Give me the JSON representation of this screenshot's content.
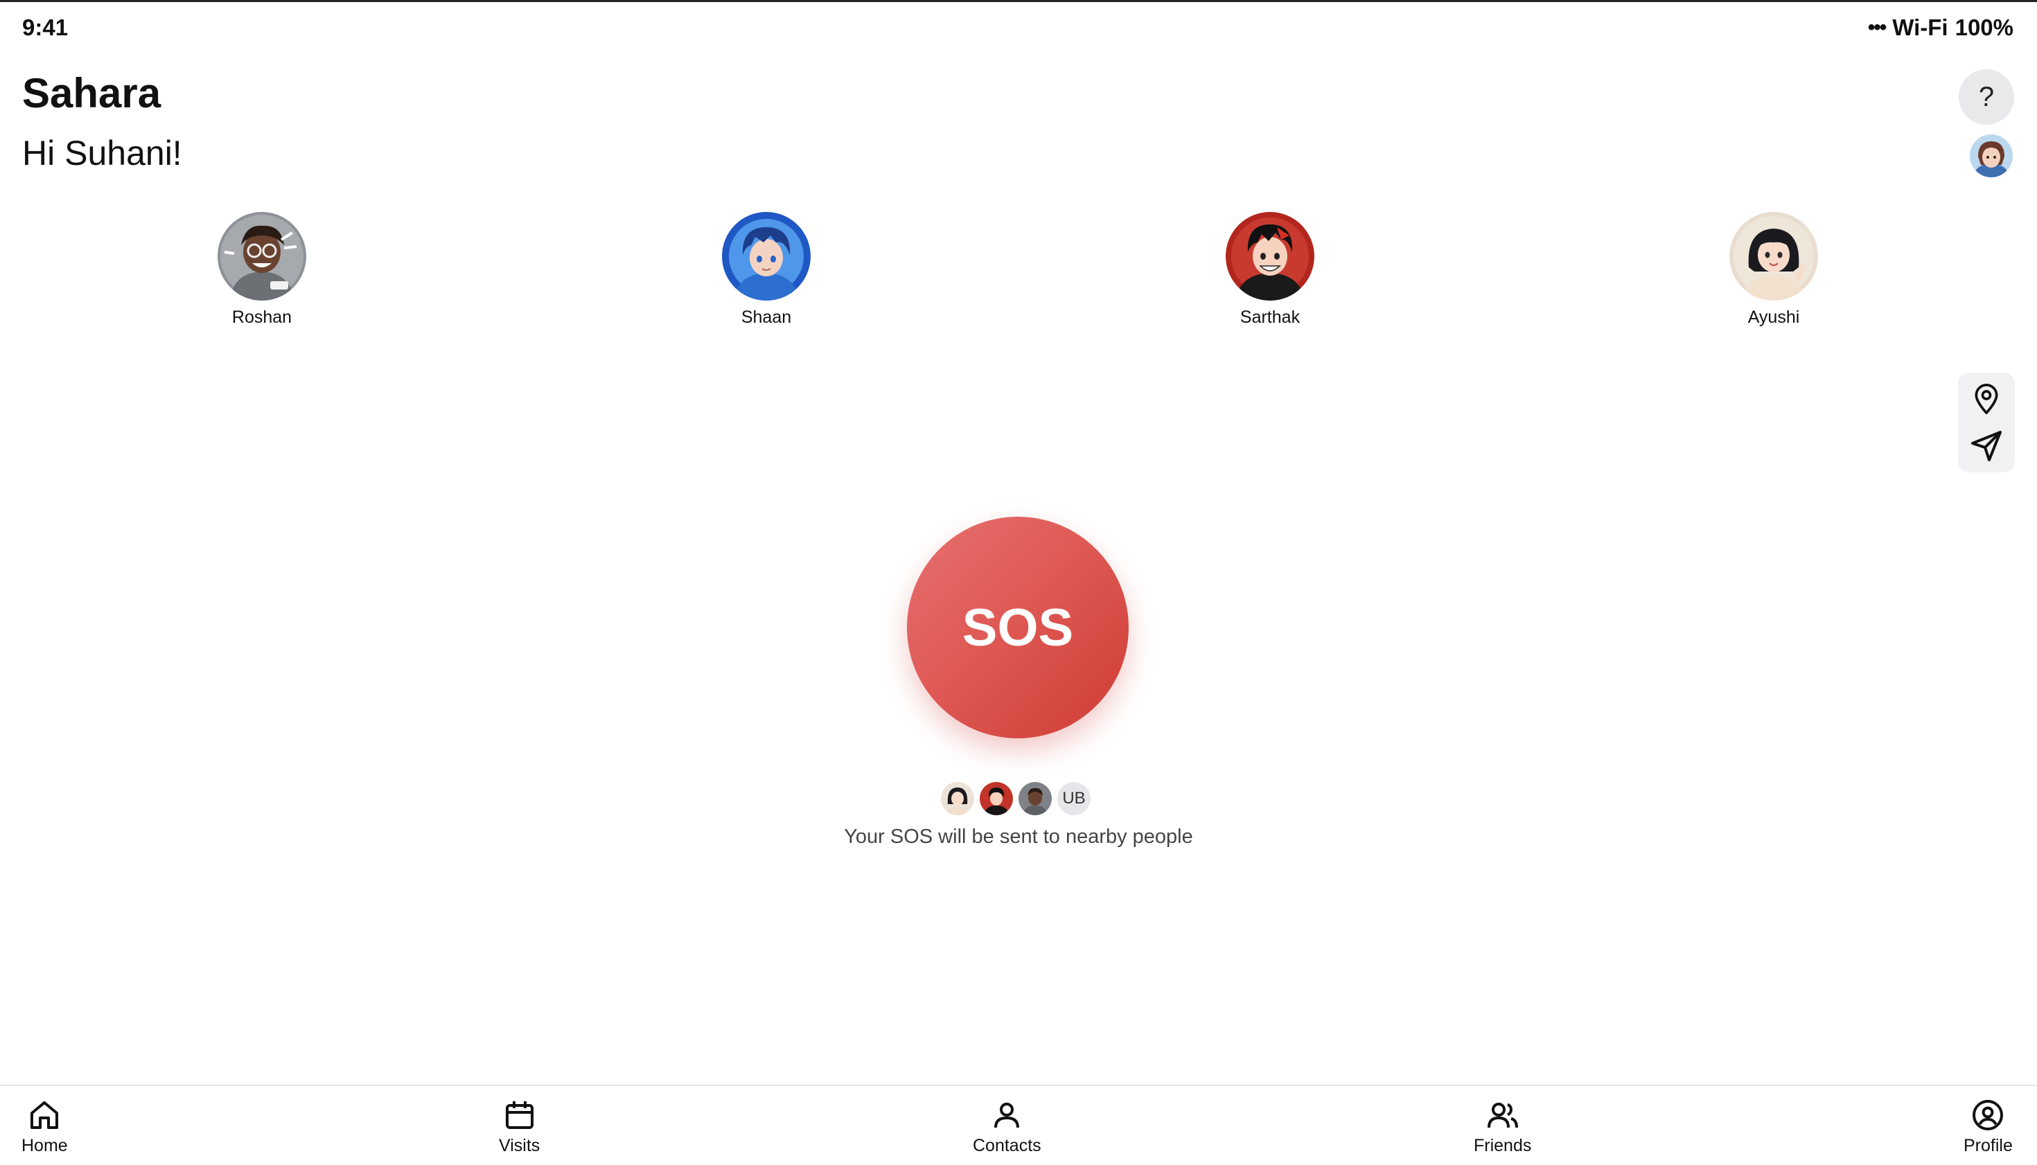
{
  "status_bar": {
    "time": "9:41",
    "dots": "•••",
    "wifi": "Wi-Fi",
    "battery": "100%"
  },
  "header": {
    "app_title": "Sahara",
    "greeting": "Hi Suhani!",
    "help_label": "?"
  },
  "contacts": [
    {
      "name": "Roshan"
    },
    {
      "name": "Shaan"
    },
    {
      "name": "Sarthak"
    },
    {
      "name": "Ayushi"
    }
  ],
  "sos": {
    "label": "SOS",
    "nearby_initials": "UB",
    "nearby_text": "Your SOS will be sent to nearby people"
  },
  "tabs": [
    {
      "label": "Home",
      "icon": "home-icon"
    },
    {
      "label": "Visits",
      "icon": "calendar-icon"
    },
    {
      "label": "Contacts",
      "icon": "person-icon"
    },
    {
      "label": "Friends",
      "icon": "friends-icon"
    },
    {
      "label": "Profile",
      "icon": "profile-circle-icon"
    }
  ],
  "colors": {
    "sos_red": "#df5a55",
    "tab_border": "#e7e7ea"
  }
}
